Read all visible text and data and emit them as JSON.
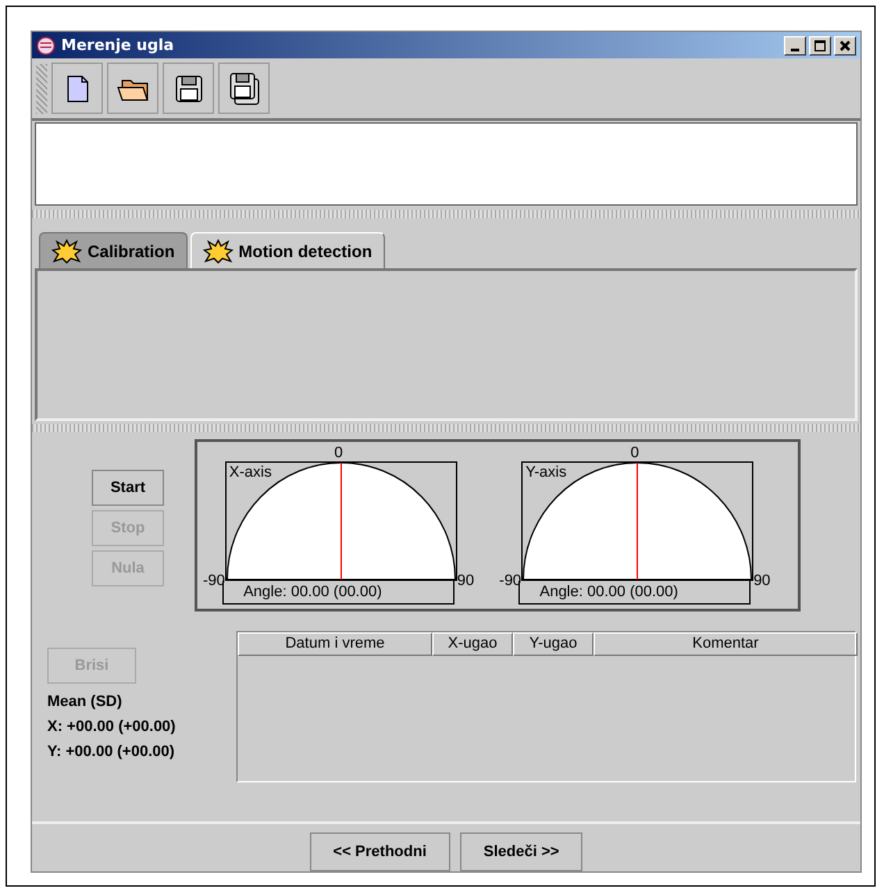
{
  "window": {
    "title": "Merenje ugla"
  },
  "toolbar": [
    {
      "kind": "new"
    },
    {
      "kind": "open"
    },
    {
      "kind": "save"
    },
    {
      "kind": "save-all"
    }
  ],
  "tabs": [
    {
      "label": "Calibration",
      "selected": false
    },
    {
      "label": "Motion detection",
      "selected": true
    }
  ],
  "controls": [
    {
      "label": "Start",
      "disabled": false
    },
    {
      "label": "Stop",
      "disabled": true
    },
    {
      "label": "Nula",
      "disabled": true
    }
  ],
  "gauges": [
    {
      "axis": "X-axis",
      "min": "-90",
      "zero": "0",
      "max": "90",
      "reading": "Angle: 00.00 (00.00)"
    },
    {
      "axis": "Y-axis",
      "min": "-90",
      "zero": "0",
      "max": "90",
      "reading": "Angle: 00.00 (00.00)"
    }
  ],
  "delete_button": {
    "label": "Brisi",
    "disabled": true
  },
  "stats": {
    "title": "Mean (SD)",
    "x": "X: +00.00 (+00.00)",
    "y": "Y: +00.00 (+00.00)"
  },
  "table": {
    "columns": [
      "Datum i vreme",
      "X-ugao",
      "Y-ugao",
      "Komentar"
    ]
  },
  "nav_buttons": [
    "<< Prethodni",
    "Sledeči >>"
  ]
}
